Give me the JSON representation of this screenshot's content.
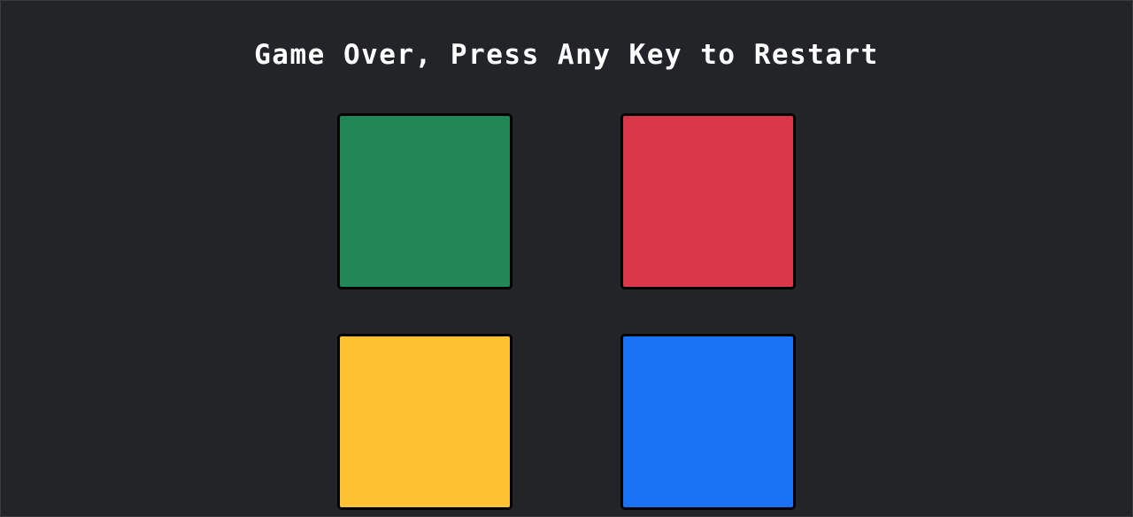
{
  "game": {
    "status_message": "Game Over, Press Any Key to Restart"
  },
  "pads": [
    {
      "name": "green",
      "color": "#218756"
    },
    {
      "name": "red",
      "color": "#db374a"
    },
    {
      "name": "yellow",
      "color": "#ffc233"
    },
    {
      "name": "blue",
      "color": "#1a73f5"
    }
  ],
  "theme": {
    "background": "#222427",
    "text": "#ffffff",
    "pad_border": "#000000"
  }
}
